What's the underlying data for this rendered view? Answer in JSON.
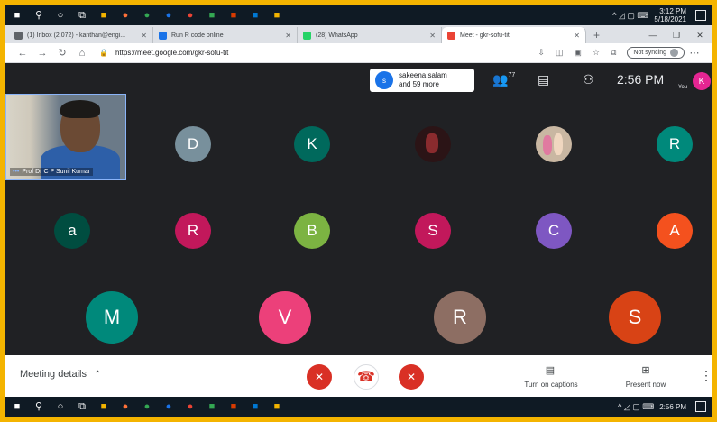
{
  "taskbar": {
    "icons": [
      {
        "name": "windows-start-icon",
        "glyph": "■",
        "color": "#ffffff"
      },
      {
        "name": "search-icon",
        "glyph": "⚲",
        "color": "#ffffff"
      },
      {
        "name": "cortana-icon",
        "glyph": "○",
        "color": "#ffffff"
      },
      {
        "name": "task-view-icon",
        "glyph": "⧉",
        "color": "#ffffff"
      },
      {
        "name": "file-explorer-icon",
        "glyph": "■",
        "color": "#f4b400"
      },
      {
        "name": "firefox-icon",
        "glyph": "●",
        "color": "#ff7139"
      },
      {
        "name": "chrome-icon",
        "glyph": "●",
        "color": "#34a853"
      },
      {
        "name": "app-icon-blue",
        "glyph": "●",
        "color": "#1a73e8"
      },
      {
        "name": "app-icon-red",
        "glyph": "●",
        "color": "#ea4335"
      },
      {
        "name": "app-icon-green",
        "glyph": "■",
        "color": "#34a853"
      },
      {
        "name": "office-icon",
        "glyph": "■",
        "color": "#d83b01"
      },
      {
        "name": "browser-icon",
        "glyph": "■",
        "color": "#0078d4"
      },
      {
        "name": "sticky-notes-icon",
        "glyph": "■",
        "color": "#f4b400"
      }
    ],
    "tray": "^ ◿ ▢ ⌨",
    "time_top": "3:12 PM",
    "date_top": "5/18/2021",
    "time_bottom": "2:56 PM",
    "date_bottom": ""
  },
  "browser": {
    "tabs": [
      {
        "label": "(1) Inbox (2,072) - kanthan@engi...",
        "favicon_color": "#5f6368",
        "active": false
      },
      {
        "label": "Run R code online",
        "favicon_color": "#1a73e8",
        "active": false
      },
      {
        "label": "(28) WhatsApp",
        "favicon_color": "#25d366",
        "active": false
      },
      {
        "label": "Meet - gkr-sofu-tit",
        "favicon_color": "#ea4335",
        "active": true
      }
    ],
    "new_tab": "+",
    "url": "https://meet.google.com/gkr-sofu-tit",
    "sync_label": "Not syncing"
  },
  "meet": {
    "presenting": {
      "initial": "s",
      "line1": "sakeena salam",
      "line2": "and 59 more"
    },
    "people_count": "77",
    "clock": "2:56 PM",
    "self_initial": "K",
    "self_label": "You",
    "video_name": "Prof Dr C P Sunil Kumar",
    "participants_row1": [
      {
        "initial": "D",
        "color": "#78909c"
      },
      {
        "initial": "K",
        "color": "#00695c"
      },
      {
        "initial": "",
        "color": "#2b1416"
      },
      {
        "initial": "",
        "color": "#c9b7a2"
      },
      {
        "initial": "R",
        "color": "#00897b"
      }
    ],
    "participants_row2": [
      {
        "initial": "a",
        "color": "#004d40"
      },
      {
        "initial": "R",
        "color": "#c2185b"
      },
      {
        "initial": "B",
        "color": "#7cb342"
      },
      {
        "initial": "S",
        "color": "#c2185b"
      },
      {
        "initial": "C",
        "color": "#7e57c2"
      },
      {
        "initial": "A",
        "color": "#f4511e"
      }
    ],
    "participants_row3": [
      {
        "initial": "M",
        "color": "#00897b"
      },
      {
        "initial": "V",
        "color": "#ec407a"
      },
      {
        "initial": "R",
        "color": "#8d6e63"
      },
      {
        "initial": "S",
        "color": "#d84315"
      }
    ]
  },
  "controls": {
    "details": "Meeting details",
    "captions": "Turn on captions",
    "present": "Present now",
    "mic_glyph": "✕",
    "end_glyph": "☎",
    "cam_glyph": "✕",
    "more_glyph": "⋮",
    "captions_glyph": "▤",
    "present_glyph": "⊞"
  }
}
